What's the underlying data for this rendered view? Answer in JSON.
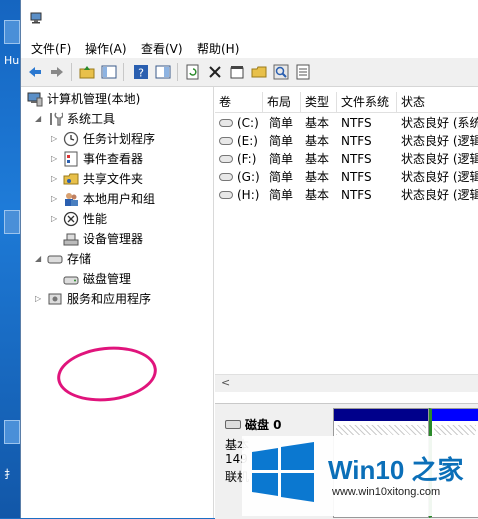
{
  "desktop": {
    "label": "Hu",
    "label2": "扌"
  },
  "menubar": {
    "items": [
      "文件(F)",
      "操作(A)",
      "查看(V)",
      "帮助(H)"
    ]
  },
  "tree": {
    "root": "计算机管理(本地)",
    "system_tools": "系统工具",
    "task_scheduler": "任务计划程序",
    "event_viewer": "事件查看器",
    "shared_folders": "共享文件夹",
    "local_users": "本地用户和组",
    "performance": "性能",
    "device_manager": "设备管理器",
    "storage": "存储",
    "disk_management": "磁盘管理",
    "services_apps": "服务和应用程序"
  },
  "volume_table": {
    "columns": [
      "卷",
      "布局",
      "类型",
      "文件系统",
      "状态"
    ],
    "rows": [
      [
        "(C:)",
        "简单",
        "基本",
        "NTFS",
        "状态良好 (系统"
      ],
      [
        "(E:)",
        "简单",
        "基本",
        "NTFS",
        "状态良好 (逻辑"
      ],
      [
        "(F:)",
        "简单",
        "基本",
        "NTFS",
        "状态良好 (逻辑"
      ],
      [
        "(G:)",
        "简单",
        "基本",
        "NTFS",
        "状态良好 (逻辑"
      ],
      [
        "(H:)",
        "简单",
        "基本",
        "NTFS",
        "状态良好 (逻辑"
      ]
    ]
  },
  "disk_panel": {
    "disk_name": "磁盘 0",
    "type": "基本",
    "size": "149",
    "status": "联机"
  },
  "watermark": {
    "title": "Win10 之家",
    "url": "www.win10xitong.com"
  },
  "colors": {
    "highlight_circle": "#e0147c",
    "watermark_blue": "#0b6fb8",
    "partition_primary": "#00008b",
    "partition_logical": "#0000ff"
  }
}
